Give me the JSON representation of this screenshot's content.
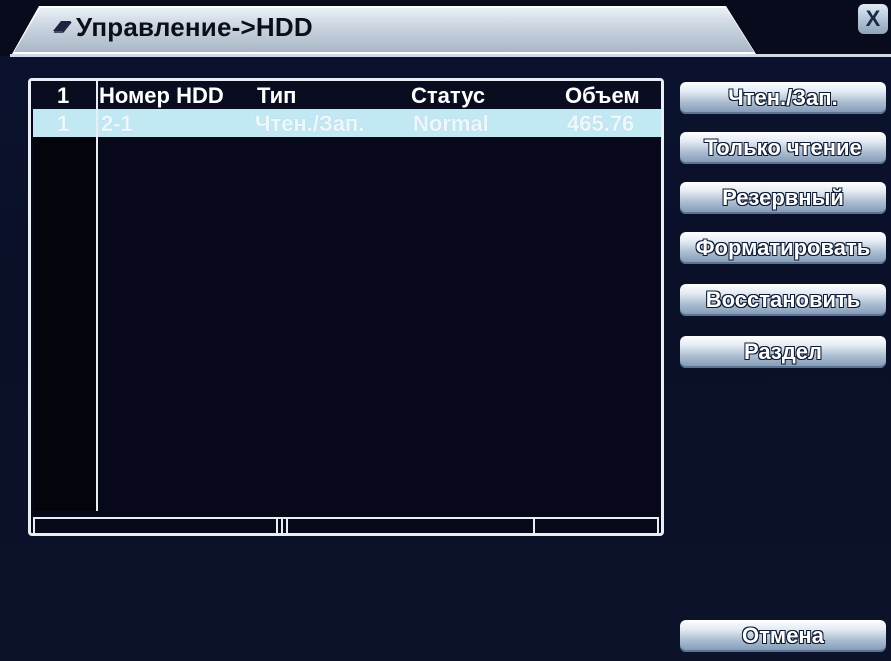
{
  "window": {
    "title": "Управление->HDD",
    "close_glyph": "X"
  },
  "table": {
    "headers": {
      "index": "1",
      "hdd_number": "Номер HDD",
      "type": "Тип",
      "status": "Статус",
      "capacity": "Объем"
    },
    "rows": [
      {
        "index": "1",
        "hdd_number": "2-1",
        "type": "Чтен./Зап.",
        "status": "Normal",
        "capacity": "465.76"
      }
    ]
  },
  "buttons": {
    "read_write": "Чтен./Зап.",
    "read_only": "Только чтение",
    "reserve": "Резервный",
    "format": "Форматировать",
    "restore": "Восстановить",
    "partition": "Раздел",
    "cancel": "Отмена"
  },
  "icons": {
    "title_icon": "book-icon",
    "close_icon": "close-icon"
  },
  "colors": {
    "background": "#0a0f22",
    "selected_row": "#c2e8f3",
    "button_gradient_top": "#ffffff",
    "button_gradient_bottom": "#7f97b3"
  }
}
